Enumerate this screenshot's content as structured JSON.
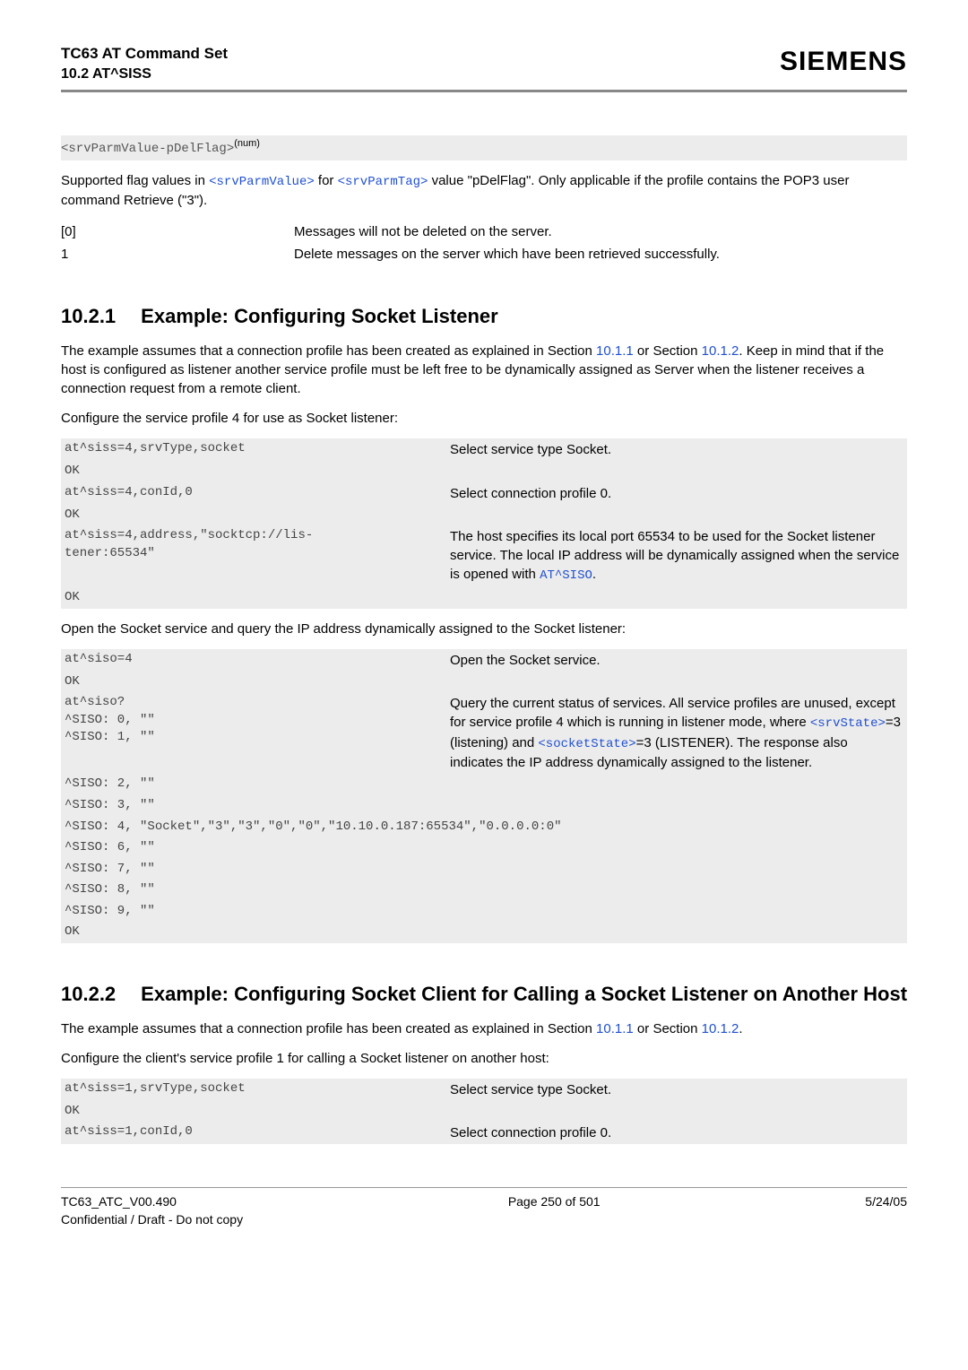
{
  "header": {
    "title": "TC63 AT Command Set",
    "sub": "10.2 AT^SISS",
    "brand": "SIEMENS"
  },
  "param": {
    "name": "<srvParmValue-pDelFlag>",
    "sup": "(num)",
    "desc_pre": "Supported flag values in ",
    "link1": "<srvParmValue>",
    "desc_mid": " for ",
    "link2": "<srvParmTag>",
    "desc_post": " value \"pDelFlag\". Only applicable if the profile contains the POP3 user command Retrieve (\"3\").",
    "rows": [
      {
        "k": "[0]",
        "v": "Messages will not be deleted on the server."
      },
      {
        "k": "1",
        "v": "Delete messages on the server which have been retrieved successfully."
      }
    ]
  },
  "sec1": {
    "num": "10.2.1",
    "title": "Example: Configuring Socket Listener",
    "p1a": "The example assumes that a connection profile has been created as explained in Section ",
    "p1link1": "10.1.1",
    "p1b": " or Section ",
    "p1link2": "10.1.2",
    "p1c": ". Keep in mind that if the host is configured as listener another service profile must be left free to be dynamically assigned as Server when the listener receives a connection request from a remote client.",
    "p2": "Configure the service profile 4 for use as Socket listener:",
    "code1": [
      {
        "l": "at^siss=4,srvType,socket",
        "r": "Select service type Socket."
      },
      {
        "l": "OK",
        "r": ""
      },
      {
        "l": "at^siss=4,conId,0",
        "r": "Select connection profile 0."
      },
      {
        "l": "OK",
        "r": ""
      },
      {
        "l": "at^siss=4,address,\"socktcp://lis-\ntener:65534\"",
        "r_pre": "The host specifies its local port 65534 to be used for the Socket listener service. The local IP address will be dynamically assigned when the service is opened with ",
        "r_link": "AT^SISO",
        "r_post": "."
      },
      {
        "l": "OK",
        "r": ""
      }
    ],
    "p3": "Open the Socket service and query the IP address dynamically assigned to the Socket listener:",
    "code2": [
      {
        "l": "at^siso=4",
        "r": "Open the Socket service."
      },
      {
        "l": "OK",
        "r": ""
      },
      {
        "l": "at^siso?\n^SISO: 0, \"\"\n^SISO: 1, \"\"",
        "r_pre": "Query the current status of services. All service profiles are unused, except for service profile 4 which is running in listener mode, where ",
        "r_link1": "<srvState>",
        "r_mid1": "=3 (listening) and ",
        "r_link2": "<socketState>",
        "r_post": "=3 (LISTENER). The response also indicates the IP address dynamically assigned to the listener."
      },
      {
        "l": "^SISO: 2, \"\"",
        "r": ""
      },
      {
        "l": "^SISO: 3, \"\"",
        "r": ""
      },
      {
        "l": "^SISO: 4, \"Socket\",\"3\",\"3\",\"0\",\"0\",\"10.10.0.187:65534\",\"0.0.0.0:0\"",
        "r": ""
      },
      {
        "l": "^SISO: 6, \"\"",
        "r": ""
      },
      {
        "l": "^SISO: 7, \"\"",
        "r": ""
      },
      {
        "l": "^SISO: 8, \"\"",
        "r": ""
      },
      {
        "l": "^SISO: 9, \"\"",
        "r": ""
      },
      {
        "l": "OK",
        "r": ""
      }
    ]
  },
  "sec2": {
    "num": "10.2.2",
    "title": "Example: Configuring Socket Client for Calling a Socket Listener on Another Host",
    "p1a": "The example assumes that a connection profile has been created as explained in Section ",
    "p1link1": "10.1.1",
    "p1b": " or Section ",
    "p1link2": "10.1.2",
    "p1c": ".",
    "p2": "Configure the client's service profile 1 for calling a Socket listener on another host:",
    "code": [
      {
        "l": "at^siss=1,srvType,socket",
        "r": "Select service type Socket."
      },
      {
        "l": "OK",
        "r": ""
      },
      {
        "l": "at^siss=1,conId,0",
        "r": "Select connection profile 0."
      }
    ]
  },
  "footer": {
    "left1": "TC63_ATC_V00.490",
    "left2": "Confidential / Draft - Do not copy",
    "center": "Page 250 of 501",
    "right": "5/24/05"
  }
}
